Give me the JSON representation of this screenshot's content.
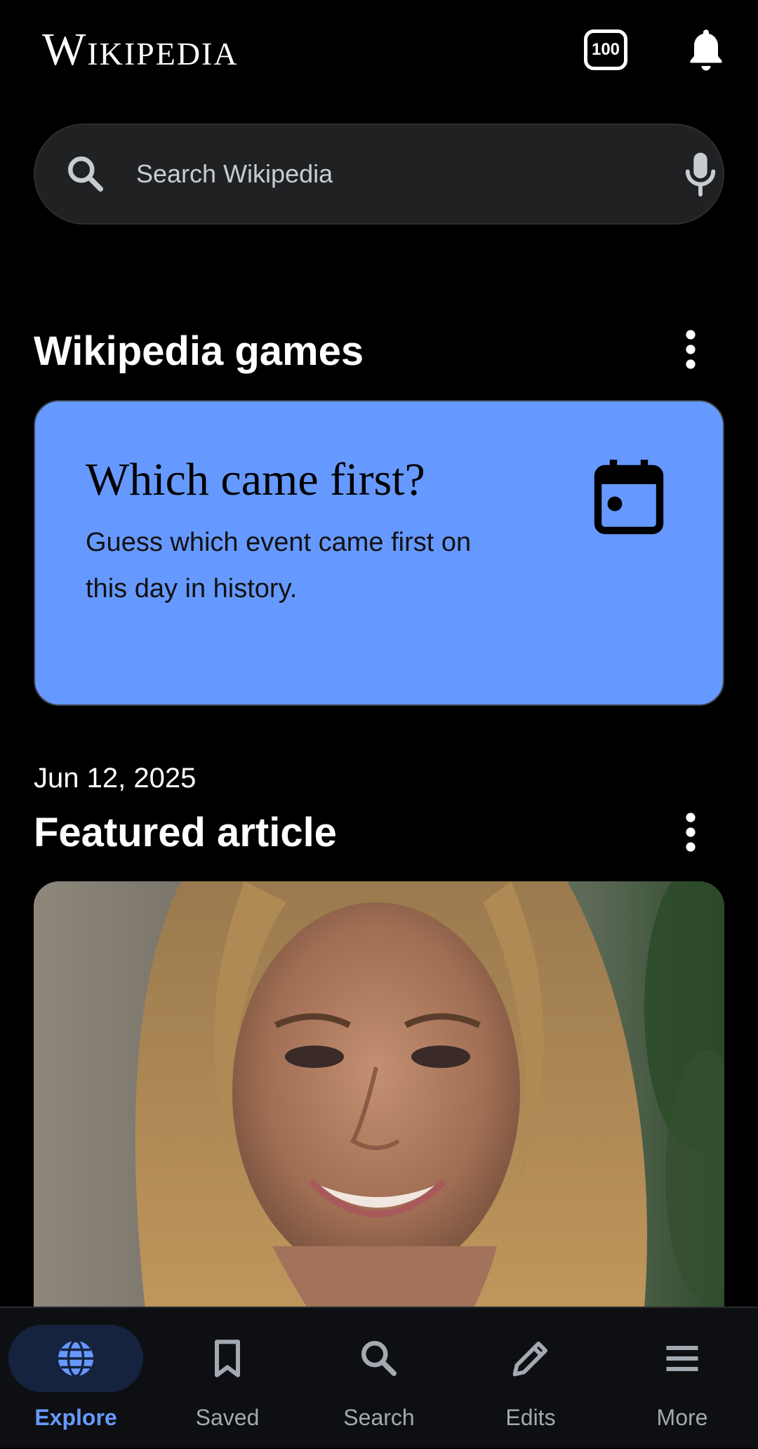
{
  "header": {
    "wordmark": "Wikipedia",
    "badge_count": "100"
  },
  "search": {
    "placeholder": "Search Wikipedia"
  },
  "games_section": {
    "title": "Wikipedia games",
    "card": {
      "title": "Which came first?",
      "description": "Guess which event came first on this day in history.",
      "background_color": "#6699ff"
    }
  },
  "featured_section": {
    "date": "Jun 12, 2025",
    "title": "Featured article"
  },
  "bottom_nav": {
    "accent_color": "#6699ff",
    "items": [
      {
        "label": "Explore",
        "icon": "globe-icon",
        "active": true
      },
      {
        "label": "Saved",
        "icon": "bookmark-icon",
        "active": false
      },
      {
        "label": "Search",
        "icon": "search-icon",
        "active": false
      },
      {
        "label": "Edits",
        "icon": "pencil-icon",
        "active": false
      },
      {
        "label": "More",
        "icon": "menu-icon",
        "active": false
      }
    ]
  }
}
